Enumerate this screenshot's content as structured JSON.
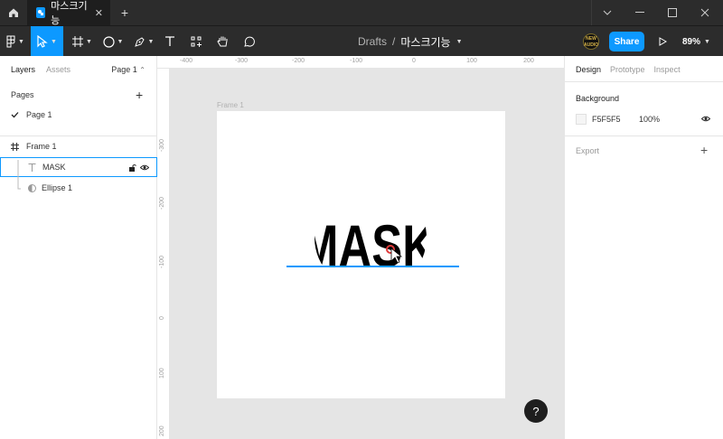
{
  "titlebar": {
    "tab_title": "마스크기능",
    "home_icon": "home-icon",
    "tab_icon": "figma-file-icon"
  },
  "toolbar": {
    "breadcrumb_folder": "Drafts",
    "breadcrumb_separator": "/",
    "file_name": "마스크기능",
    "share_label": "Share",
    "zoom": "89%",
    "avatar_text": "NEW\nAUDIO",
    "accent_color": "#0d99ff"
  },
  "left_panel": {
    "tabs": [
      "Layers",
      "Assets"
    ],
    "page_selector": "Page 1",
    "pages_heading": "Pages",
    "pages": [
      "Page 1"
    ],
    "layers": [
      {
        "name": "Frame 1",
        "icon": "frame-hash-icon"
      },
      {
        "name": "MASK",
        "icon": "text-icon"
      },
      {
        "name": "Ellipse 1",
        "icon": "mask-icon"
      }
    ]
  },
  "canvas": {
    "frame_label": "Frame 1",
    "ruler_top": [
      "-400",
      "-300",
      "-200",
      "-100",
      "0",
      "100",
      "200"
    ],
    "ruler_left": [
      "-300",
      "-200",
      "-100",
      "0",
      "100",
      "200"
    ],
    "text_content": "MASK",
    "help_label": "?"
  },
  "right_panel": {
    "tabs": [
      "Design",
      "Prototype",
      "Inspect"
    ],
    "background_heading": "Background",
    "background_hex": "F5F5F5",
    "background_opacity": "100%",
    "export_heading": "Export"
  }
}
